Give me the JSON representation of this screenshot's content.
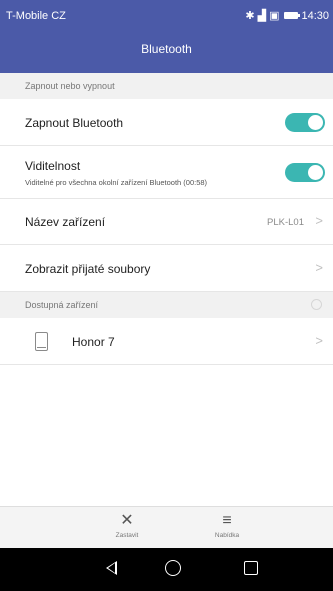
{
  "status_bar": {
    "carrier": "T-Mobile CZ",
    "time": "14:30",
    "icons": [
      "bluetooth-icon",
      "signal-icon",
      "sim-icon",
      "battery-icon"
    ]
  },
  "title_bar": {
    "title": "Bluetooth"
  },
  "sections": {
    "toggle_section": "Zapnout nebo vypnout",
    "devices_section": "Dostupná zařízení"
  },
  "settings": {
    "bluetooth": {
      "label": "Zapnout Bluetooth",
      "state": "on"
    },
    "visibility": {
      "label": "Viditelnost",
      "subtitle": "Viditelné pro všechna okolní zařízení Bluetooth (00:58)",
      "state": "on"
    },
    "device_name": {
      "label": "Název zařízení",
      "value": "PLK-L01"
    },
    "received_files": {
      "label": "Zobrazit přijaté soubory"
    }
  },
  "devices": [
    {
      "name": "Honor 7",
      "icon": "phone-icon"
    }
  ],
  "bottom_bar": {
    "stop_label": "Zastavit",
    "menu_label": "Nabídka"
  },
  "colors": {
    "header": "#4b5aa8",
    "accent": "#3bb6b2"
  }
}
